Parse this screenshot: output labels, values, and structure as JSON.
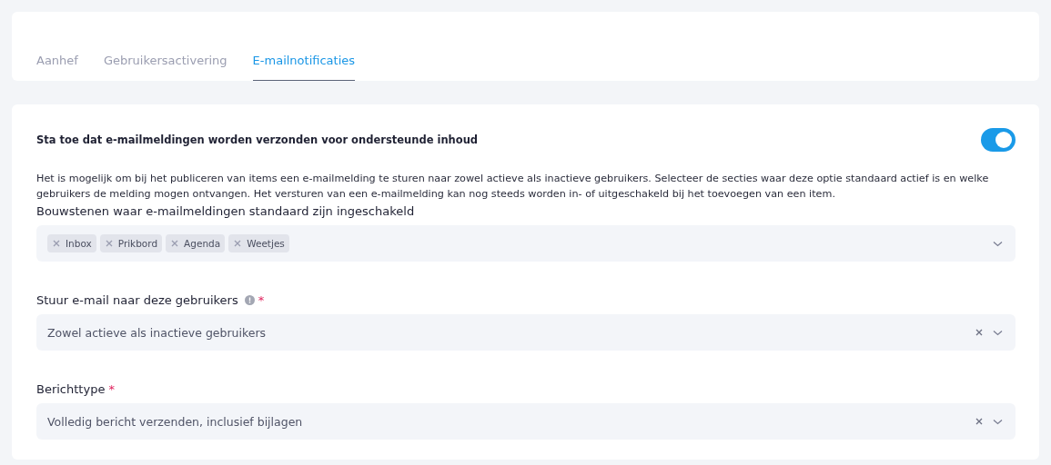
{
  "tabs": [
    {
      "label": "Aanhef",
      "selected": false
    },
    {
      "label": "Gebruikersactivering",
      "selected": false
    },
    {
      "label": "E-mailnotificaties",
      "selected": true
    }
  ],
  "setting": {
    "title": "Sta toe dat e-mailmeldingen worden verzonden voor ondersteunde inhoud",
    "on": true,
    "description": "Het is mogelijk om bij het publiceren van items een e-mailmelding te sturen naar zowel actieve als inactieve gebruikers. Selecteer de secties waar deze optie standaard actief is en welke gebruikers de melding mogen ontvangen. Het versturen van een e-mailmelding kan nog steeds worden in- of uitgeschakeld bij het toevoegen van een item."
  },
  "fields": [
    {
      "kind": "multi",
      "label": "Bouwstenen waar e-mailmeldingen standaard zijn ingeschakeld",
      "info": false,
      "tags": [
        "Inbox",
        "Prikbord",
        "Agenda",
        "Weetjes"
      ],
      "clearable": false
    },
    {
      "kind": "single",
      "label": "Stuur e-mail naar deze gebruikers",
      "info": true,
      "required_mark": "*",
      "value": "Zowel actieve als inactieve gebruikers",
      "clearable": true
    },
    {
      "kind": "single",
      "label": "Berichttype",
      "info": false,
      "required_mark": "*",
      "value": "Volledig bericht verzenden, inclusief bijlagen",
      "clearable": true
    }
  ]
}
